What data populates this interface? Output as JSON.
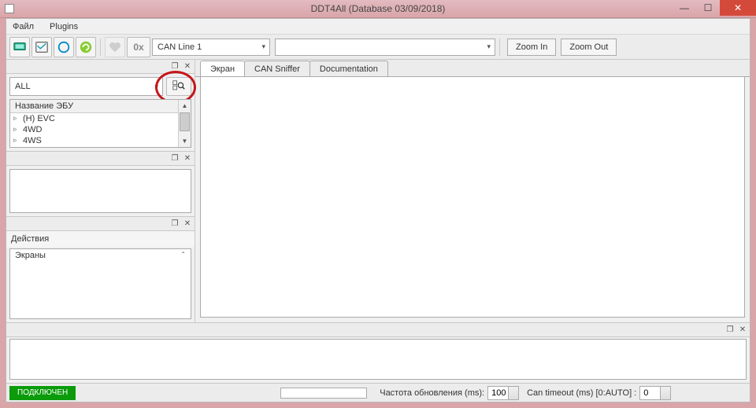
{
  "window": {
    "title": "DDT4All (Database 03/09/2018)"
  },
  "menu": {
    "file": "Файл",
    "plugins": "Plugins"
  },
  "toolbar": {
    "can_line": "CAN Line 1",
    "empty_combo": "",
    "zoom_in": "Zoom In",
    "zoom_out": "Zoom Out"
  },
  "filter": {
    "all": "ALL"
  },
  "tree": {
    "header": "Название ЭБУ",
    "items": [
      "(H) EVC",
      "4WD",
      "4WS"
    ]
  },
  "actions": {
    "title": "Действия",
    "screens": "Экраны"
  },
  "tabs": {
    "t1": "Экран",
    "t2": "CAN Sniffer",
    "t3": "Documentation"
  },
  "status": {
    "connected": "ПОДКЛЮЧЕН",
    "refresh_label": "Частота обновления (ms):",
    "refresh_value": "100",
    "timeout_label": "Can timeout (ms) [0:AUTO] :",
    "timeout_value": "0"
  }
}
